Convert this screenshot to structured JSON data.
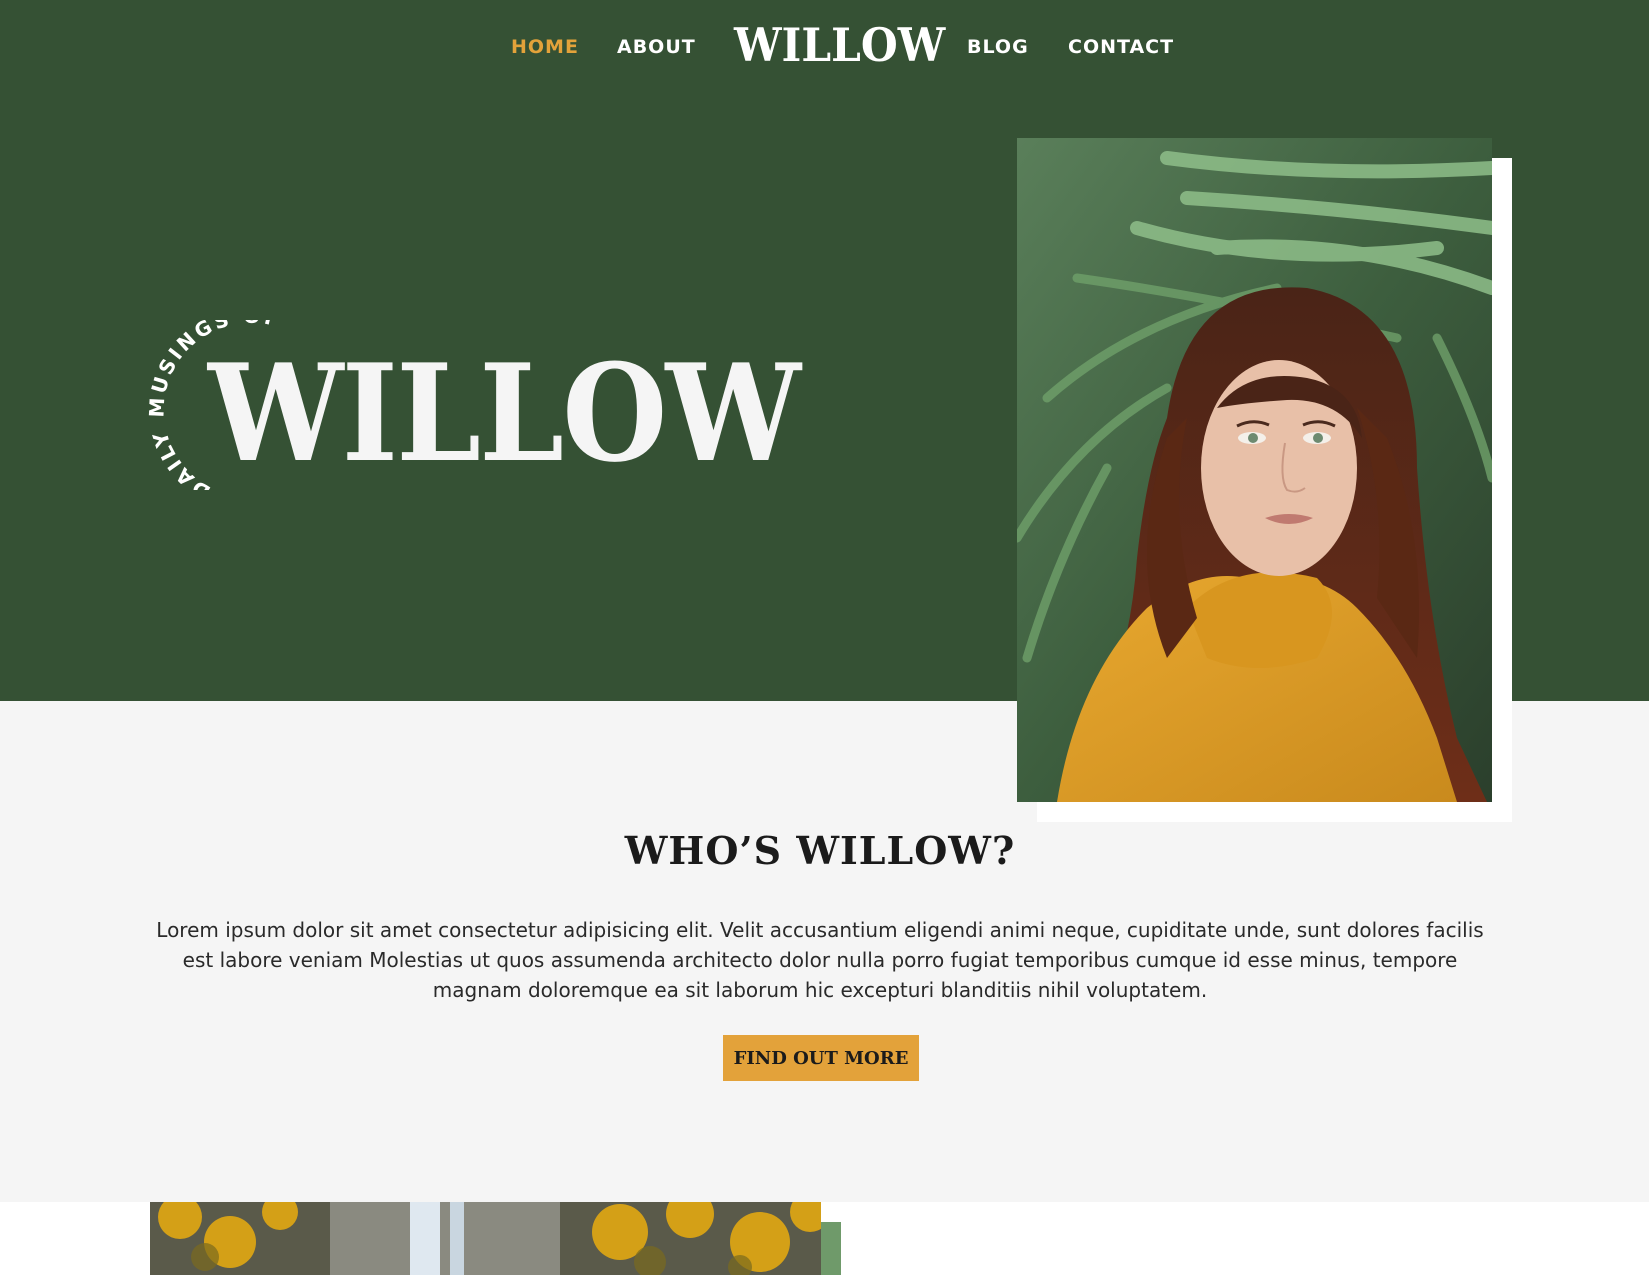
{
  "nav": {
    "items": [
      {
        "label": "HOME",
        "active": true
      },
      {
        "label": "ABOUT",
        "active": false
      },
      {
        "label": "BLOG",
        "active": false
      },
      {
        "label": "CONTACT",
        "active": false
      }
    ],
    "logo": "WILLOW"
  },
  "hero": {
    "arc_text": "DAILY MUSINGS OF",
    "title": "WILLOW",
    "image": "woman-yellow-jacket-palm-leaves"
  },
  "about": {
    "title": "WHO’S WILLOW?",
    "text": "Lorem ipsum dolor sit amet consectetur adipisicing elit. Velit accusantium eligendi animi neque, cupiditate unde, sunt dolores facilis est labore veniam Molestias ut quos assumenda architecto dolor nulla porro fugiat temporibus cumque id esse minus, tempore magnam doloremque ea sit laborum hic excepturi blanditiis nihil voluptatem.",
    "button_label": "FIND OUT MORE"
  },
  "bottom": {
    "image": "waterfall-autumn-trees"
  },
  "colors": {
    "hero_bg": "#355134",
    "accent": "#e3a23a",
    "page_bg": "#f5f5f5",
    "secondary_green": "#6f9a6a"
  }
}
